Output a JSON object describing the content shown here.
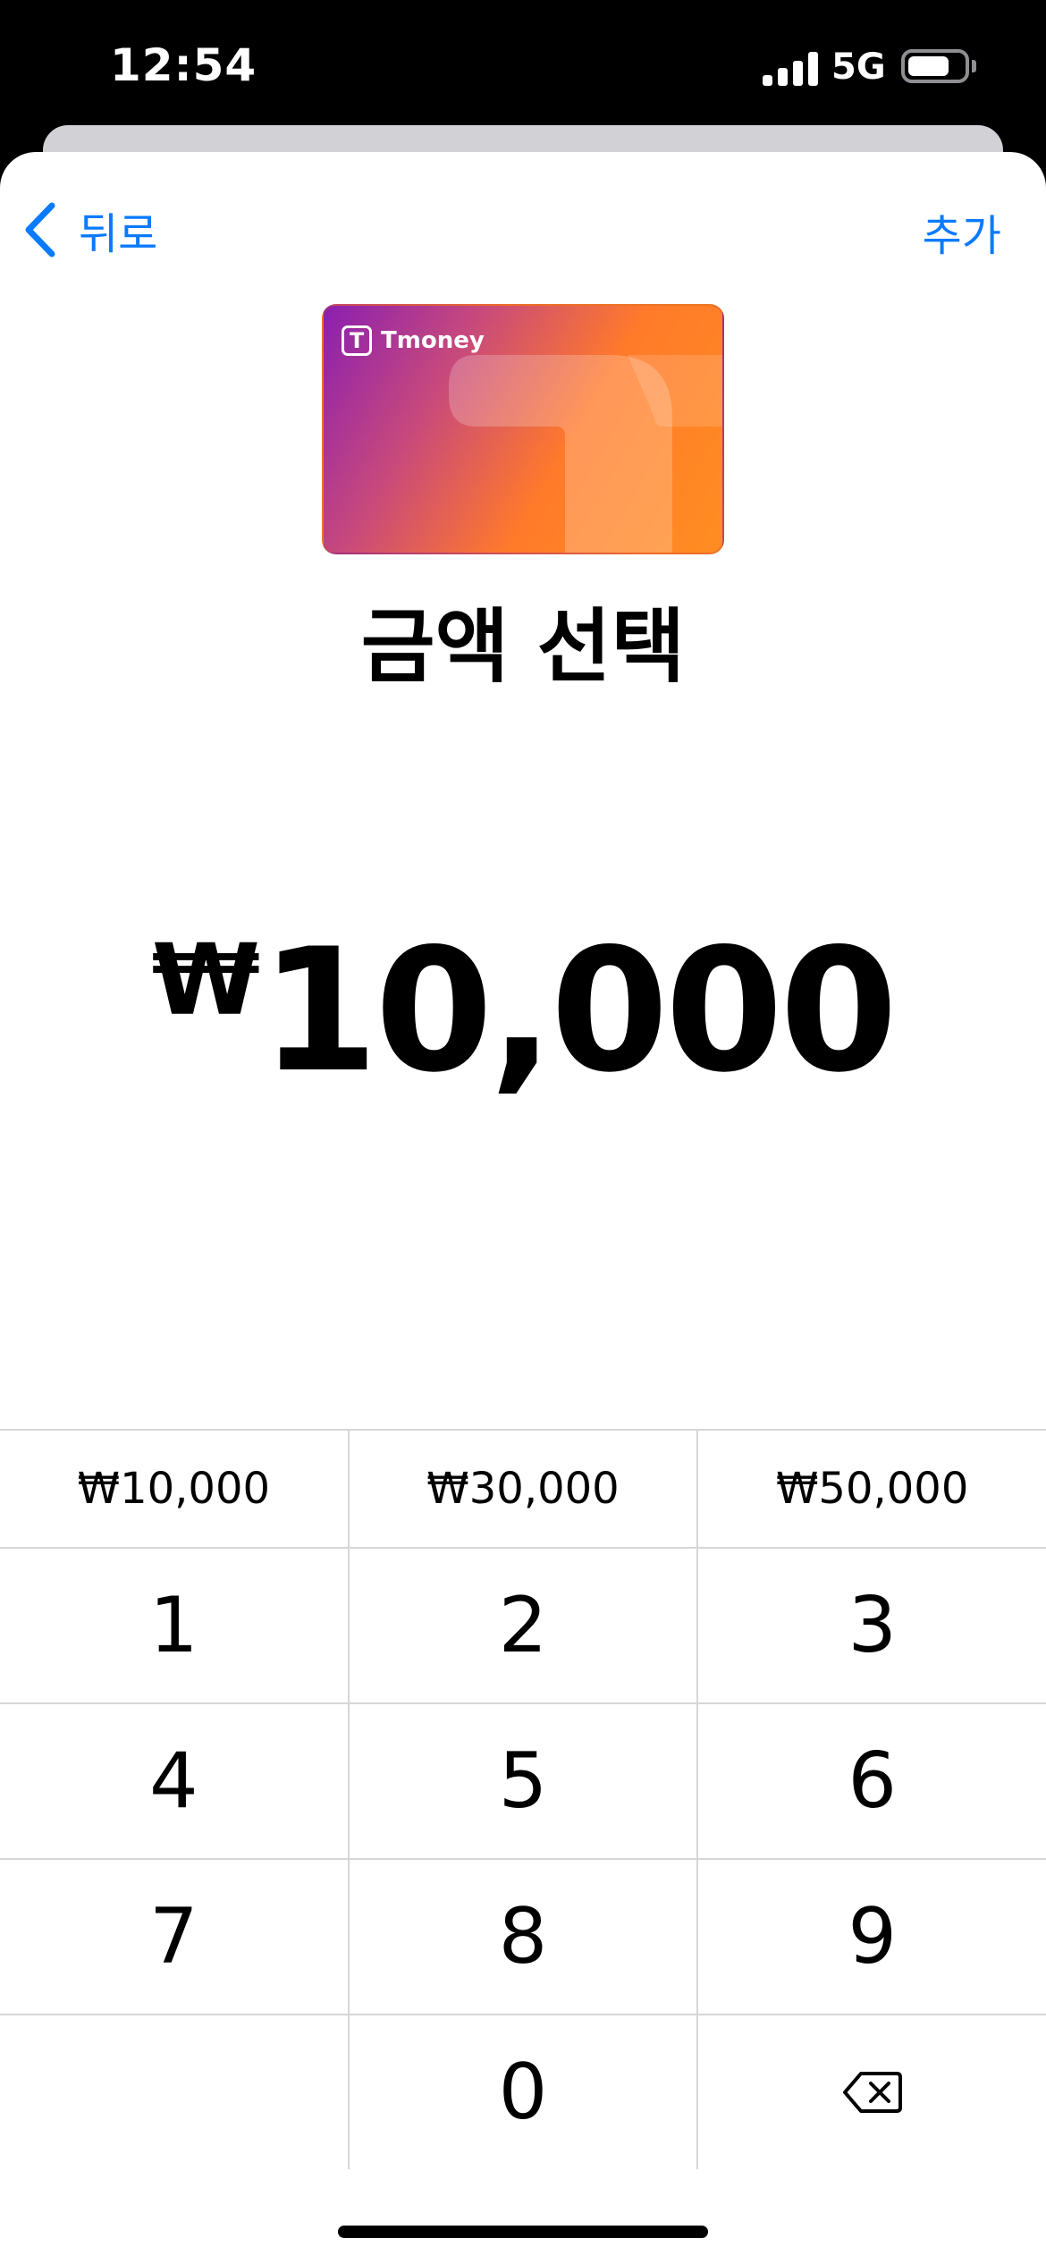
{
  "status_bar": {
    "time": "12:54",
    "network": "5G",
    "battery_level": 0.75
  },
  "nav": {
    "back_label": "뒤로",
    "action_label": "추가"
  },
  "card": {
    "brand": "Tmoney",
    "logo_letter": "T"
  },
  "title": "금액 선택",
  "amount": {
    "currency": "₩",
    "value": "10,000"
  },
  "presets": [
    "₩10,000",
    "₩30,000",
    "₩50,000"
  ],
  "keys": {
    "row1": [
      "1",
      "2",
      "3"
    ],
    "row2": [
      "4",
      "5",
      "6"
    ],
    "row3": [
      "7",
      "8",
      "9"
    ],
    "row4": [
      "",
      "0"
    ]
  },
  "icons": {
    "back": "chevron-left-icon",
    "delete": "delete-backspace-icon"
  },
  "colors": {
    "accent": "#0a7aff"
  }
}
